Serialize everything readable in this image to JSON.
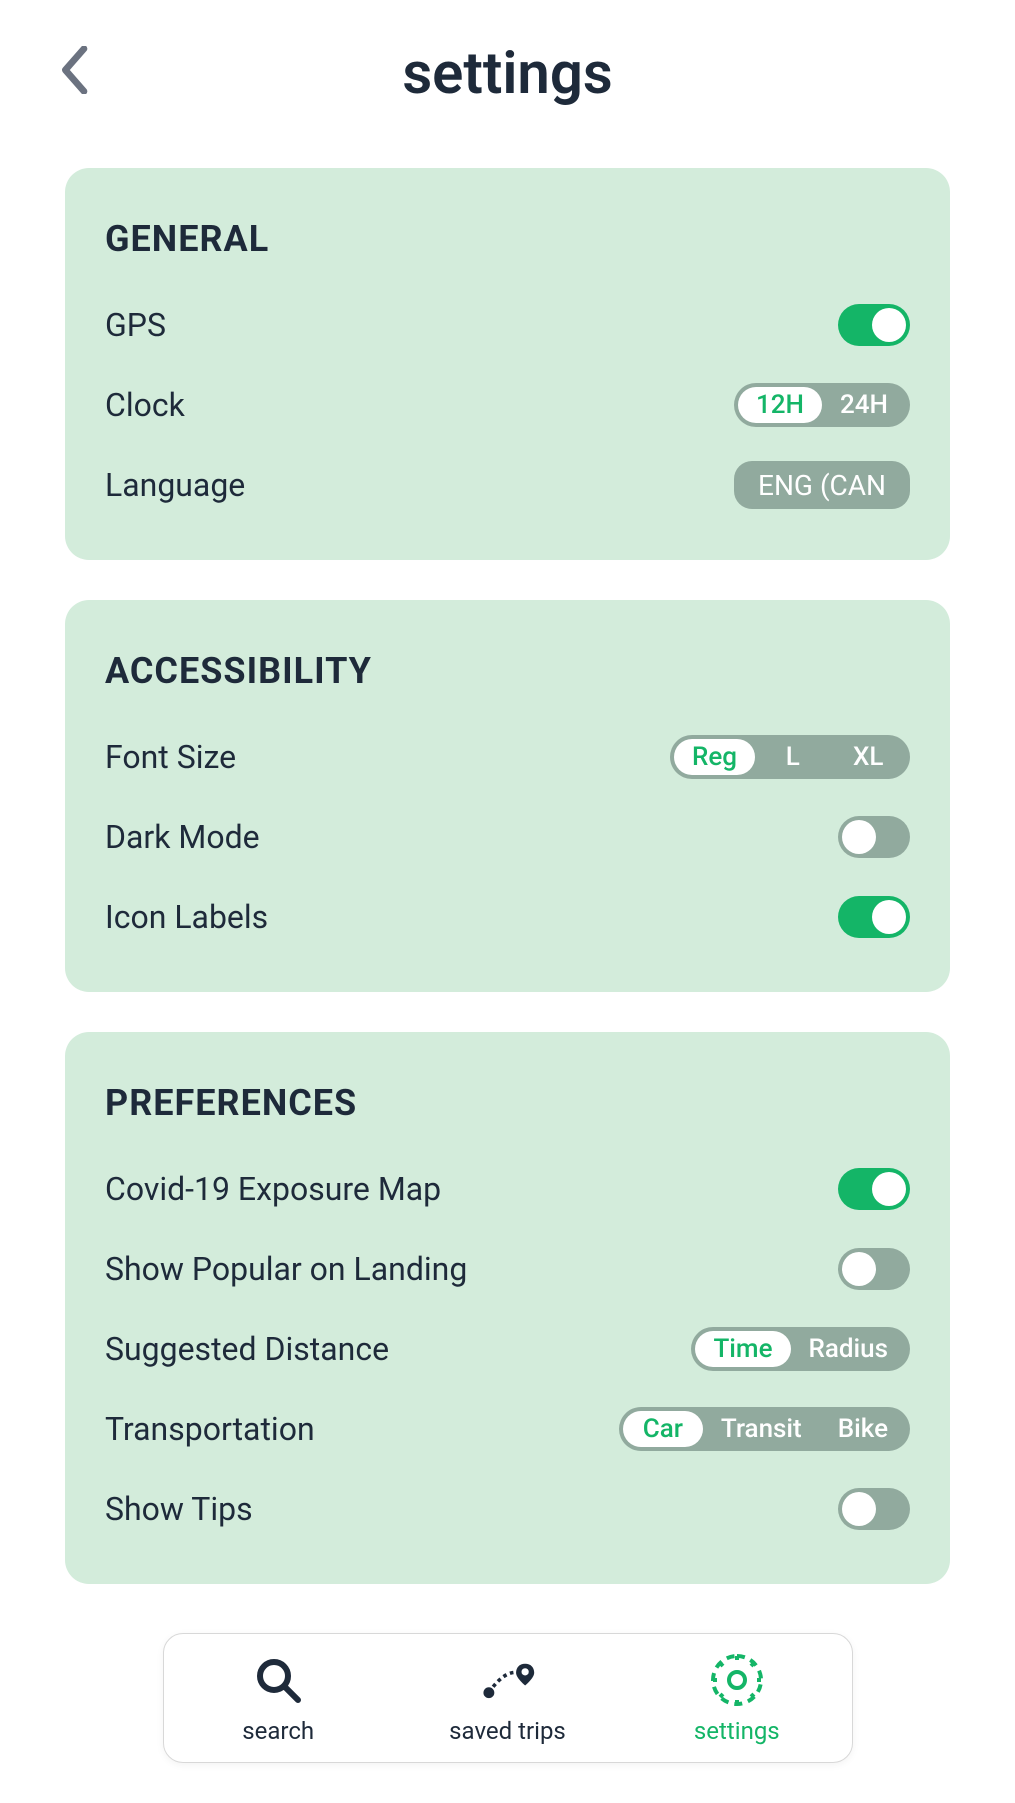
{
  "header": {
    "title": "settings"
  },
  "sections": {
    "general": {
      "title": "GENERAL",
      "gps": {
        "label": "GPS",
        "on": true
      },
      "clock": {
        "label": "Clock",
        "options": [
          "12H",
          "24H"
        ],
        "selected": "12H"
      },
      "language": {
        "label": "Language",
        "value": "ENG (CAN"
      }
    },
    "accessibility": {
      "title": "ACCESSIBILITY",
      "fontSize": {
        "label": "Font Size",
        "options": [
          "Reg",
          "L",
          "XL"
        ],
        "selected": "Reg"
      },
      "darkMode": {
        "label": "Dark Mode",
        "on": false
      },
      "iconLabels": {
        "label": "Icon Labels",
        "on": true
      }
    },
    "preferences": {
      "title": "PREFERENCES",
      "covidMap": {
        "label": "Covid-19 Exposure Map",
        "on": true
      },
      "showPopular": {
        "label": "Show Popular on Landing",
        "on": false
      },
      "suggestedDistance": {
        "label": "Suggested Distance",
        "options": [
          "Time",
          "Radius"
        ],
        "selected": "Time"
      },
      "transportation": {
        "label": "Transportation",
        "options": [
          "Car",
          "Transit",
          "Bike"
        ],
        "selected": "Car"
      },
      "showTips": {
        "label": "Show Tips",
        "on": false
      }
    }
  },
  "nav": {
    "search": {
      "label": "search"
    },
    "savedTrips": {
      "label": "saved trips"
    },
    "settings": {
      "label": "settings"
    }
  },
  "colors": {
    "accent": "#14b567",
    "card": "#d3ecdb",
    "muted": "#91aa9e",
    "text": "#1e2a3a"
  }
}
